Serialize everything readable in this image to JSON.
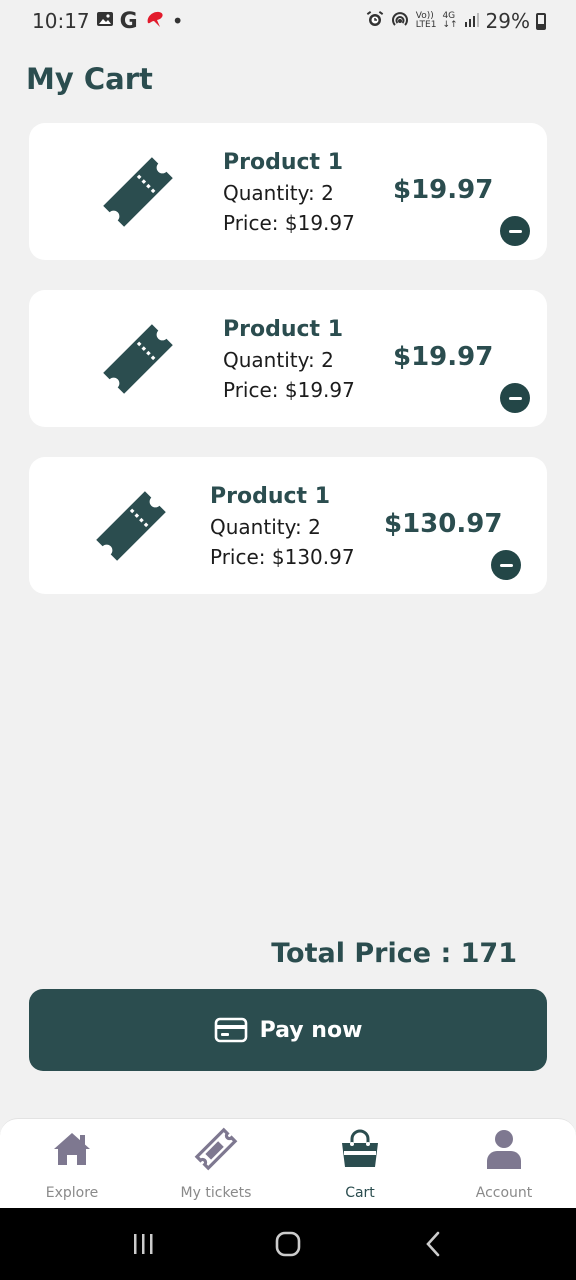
{
  "status_bar": {
    "time": "10:17",
    "g_letter": "G",
    "dot": "•",
    "volte_top": "Vo))",
    "volte_bottom": "LTE1",
    "network": "4G",
    "battery": "29%"
  },
  "page": {
    "title": "My Cart"
  },
  "cart": {
    "items": [
      {
        "name": "Product 1",
        "quantity": "Quantity: 2",
        "price": "Price: $19.97",
        "total": "$19.97"
      },
      {
        "name": "Product 1",
        "quantity": "Quantity: 2",
        "price": "Price: $19.97",
        "total": "$19.97"
      },
      {
        "name": "Product 1",
        "quantity": "Quantity: 2",
        "price": "Price: $130.97",
        "total": "$130.97"
      }
    ]
  },
  "summary": {
    "total_label": "Total Price : 171"
  },
  "pay": {
    "label": "Pay now"
  },
  "nav": {
    "items": [
      {
        "label": "Explore",
        "icon": "home-icon"
      },
      {
        "label": "My tickets",
        "icon": "ticket-icon"
      },
      {
        "label": "Cart",
        "icon": "bag-icon"
      },
      {
        "label": "Account",
        "icon": "user-icon"
      }
    ],
    "active": "Cart"
  },
  "colors": {
    "primary": "#2b4d4f",
    "background": "#f1f1f1",
    "card": "#ffffff",
    "nav_inactive": "#8a8496"
  }
}
